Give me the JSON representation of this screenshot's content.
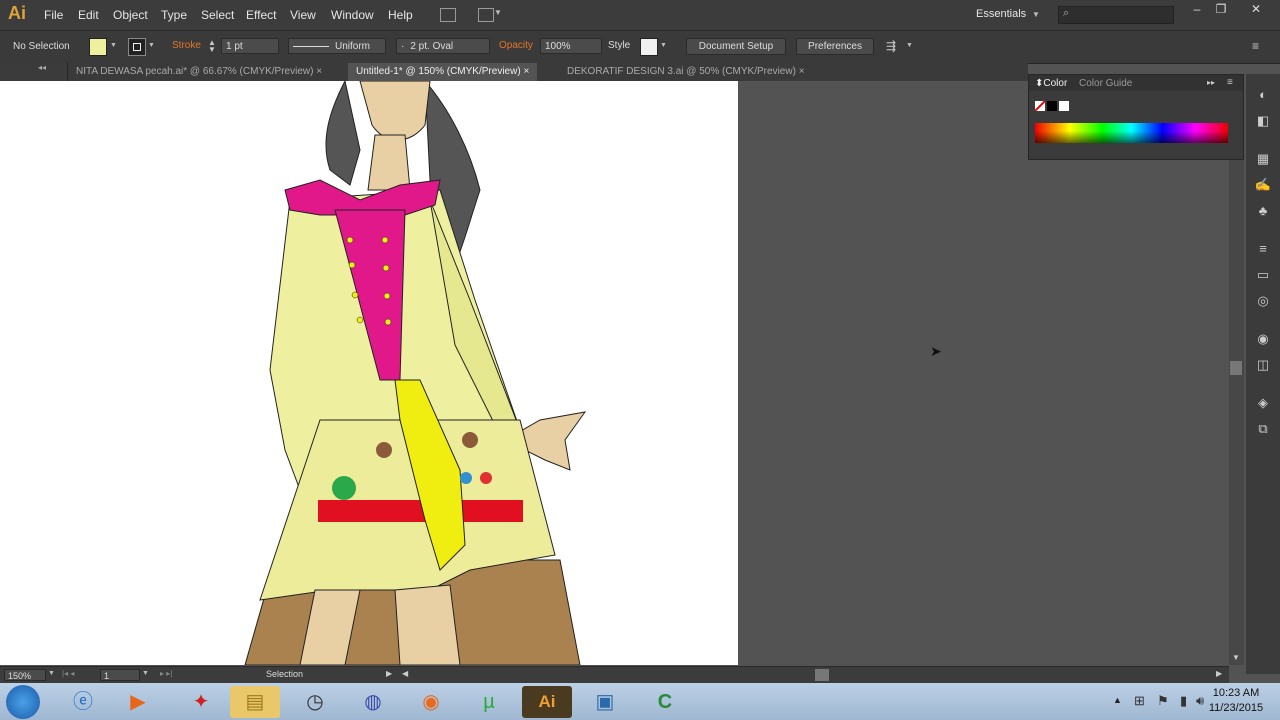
{
  "app": {
    "logo": "Ai"
  },
  "menu": [
    "File",
    "Edit",
    "Object",
    "Type",
    "Select",
    "Effect",
    "View",
    "Window",
    "Help"
  ],
  "workspace": {
    "label": "Essentials",
    "search_placeholder": ""
  },
  "control": {
    "selection": "No Selection",
    "stroke_label": "Stroke",
    "stroke_weight": "1 pt",
    "stroke_profile": "Uniform",
    "brush": "2 pt. Oval",
    "opacity_label": "Opacity",
    "opacity_value": "100%",
    "style_label": "Style",
    "document_setup": "Document Setup",
    "preferences": "Preferences"
  },
  "tabs": [
    {
      "label": "NITA DEWASA pecah.ai* @ 66.67% (CMYK/Preview)",
      "active": false
    },
    {
      "label": "Untitled-1* @ 150% (CMYK/Preview)",
      "active": true
    },
    {
      "label": "DEKORATIF DESIGN 3.ai @ 50% (CMYK/Preview)",
      "active": false
    }
  ],
  "tab_close": "×",
  "color_panel": {
    "tab_color": "Color",
    "tab_guide": "Color Guide"
  },
  "status": {
    "zoom": "150%",
    "artboard_number": "1",
    "tool_name": "Selection"
  },
  "clock": {
    "time": "10:23 AM",
    "date": "11/23/2015"
  },
  "colors": {
    "fill": "#eef0a0",
    "skirt": "#ecec9a",
    "collar": "#e0188a",
    "accent": "#f0ee10"
  }
}
